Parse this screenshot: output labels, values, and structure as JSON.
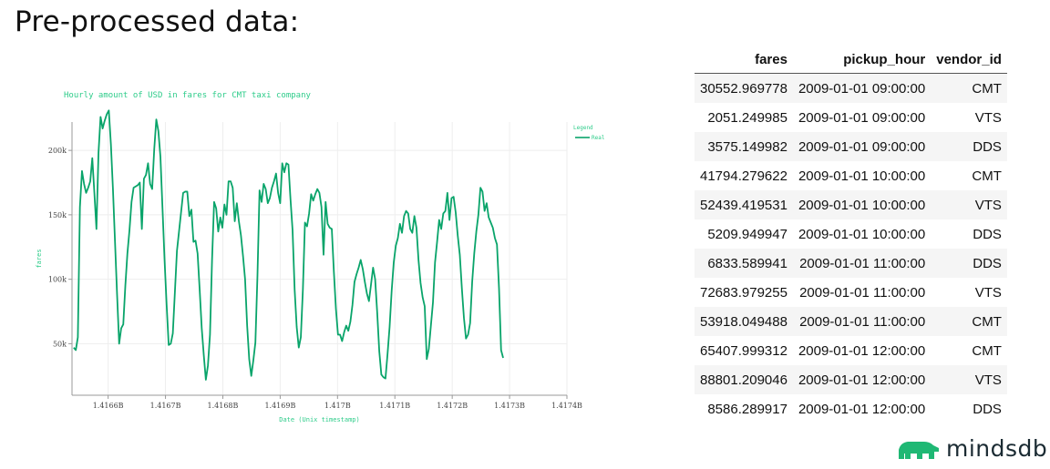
{
  "slide": {
    "title": "Pre-processed data:"
  },
  "colors": {
    "line": "#09a46a",
    "chart_text": "#2ecc8a",
    "axis": "#999999",
    "grid": "#eeeeee",
    "logo": "#1fb874"
  },
  "chart_data": {
    "type": "line",
    "title": "Hourly amount of USD in fares for CMT taxi company",
    "xlabel": "Date (Unix timestamp)",
    "ylabel": "fares",
    "legend": {
      "title": "Legend",
      "position": "top-right",
      "entries": [
        "Real"
      ]
    },
    "grid": true,
    "x_ticks": [
      "1.4166B",
      "1.4167B",
      "1.4168B",
      "1.4169B",
      "1.417B",
      "1.4171B",
      "1.4172B",
      "1.4173B",
      "1.4174B"
    ],
    "x_tick_values": [
      1416600000,
      1416700000,
      1416800000,
      1416900000,
      1417000000,
      1417100000,
      1417200000,
      1417300000,
      1417400000
    ],
    "y_ticks": [
      "50k",
      "100k",
      "150k",
      "200k"
    ],
    "y_tick_values": [
      50000,
      100000,
      150000,
      200000
    ],
    "xlim": [
      1416537000,
      1417400000
    ],
    "ylim": [
      10000,
      222000
    ],
    "series": [
      {
        "name": "Real",
        "x_start": 1416540000,
        "x_step": 3600,
        "values": [
          47000,
          45000,
          55000,
          156000,
          184000,
          174000,
          167000,
          171000,
          176000,
          194000,
          167000,
          139000,
          198000,
          226000,
          217000,
          223000,
          228000,
          231000,
          205000,
          170000,
          129000,
          88000,
          50000,
          62000,
          65000,
          95000,
          120000,
          138000,
          160000,
          171000,
          172000,
          173000,
          175000,
          139000,
          178000,
          181000,
          190000,
          174000,
          170000,
          201000,
          224000,
          215000,
          195000,
          155000,
          115000,
          80000,
          49000,
          50000,
          58000,
          90000,
          122000,
          137000,
          152000,
          167000,
          168000,
          168000,
          149000,
          154000,
          129000,
          130000,
          120000,
          92000,
          62000,
          41000,
          22000,
          33000,
          57000,
          115000,
          160000,
          155000,
          137000,
          148000,
          140000,
          158000,
          150000,
          176000,
          176000,
          171000,
          145000,
          159000,
          145000,
          134000,
          118000,
          100000,
          64000,
          38000,
          25000,
          37000,
          51000,
          103000,
          169000,
          160000,
          174000,
          170000,
          159000,
          163000,
          171000,
          176000,
          182000,
          167000,
          159000,
          190000,
          183000,
          190000,
          189000,
          162000,
          138000,
          92000,
          63000,
          47000,
          55000,
          92000,
          144000,
          141000,
          151000,
          166000,
          161000,
          166000,
          170000,
          167000,
          156000,
          119000,
          160000,
          143000,
          140000,
          139000,
          106000,
          77000,
          57000,
          57000,
          52000,
          59000,
          64000,
          60000,
          67000,
          80000,
          98000,
          104000,
          109000,
          115000,
          108000,
          98000,
          89000,
          83000,
          96000,
          109000,
          100000,
          74000,
          44000,
          26000,
          24000,
          23000,
          42000,
          63000,
          91000,
          113000,
          126000,
          132000,
          143000,
          136000,
          149000,
          153000,
          151000,
          139000,
          136000,
          149000,
          140000,
          115000,
          97000,
          86000,
          79000,
          38000,
          46000,
          64000,
          82000,
          113000,
          129000,
          146000,
          139000,
          151000,
          153000,
          167000,
          146000,
          163000,
          164000,
          152000,
          134000,
          119000,
          93000,
          70000,
          54000,
          57000,
          66000,
          98000,
          120000,
          137000,
          150000,
          171000,
          168000,
          153000,
          159000,
          148000,
          144000,
          140000,
          132000,
          127000,
          93000,
          45000,
          39000
        ]
      }
    ]
  },
  "table": {
    "columns": [
      "fares",
      "pickup_hour",
      "vendor_id"
    ],
    "rows": [
      [
        "30552.969778",
        "2009-01-01 09:00:00",
        "CMT"
      ],
      [
        "2051.249985",
        "2009-01-01 09:00:00",
        "VTS"
      ],
      [
        "3575.149982",
        "2009-01-01 09:00:00",
        "DDS"
      ],
      [
        "41794.279622",
        "2009-01-01 10:00:00",
        "CMT"
      ],
      [
        "52439.419531",
        "2009-01-01 10:00:00",
        "VTS"
      ],
      [
        "5209.949947",
        "2009-01-01 10:00:00",
        "DDS"
      ],
      [
        "6833.589941",
        "2009-01-01 11:00:00",
        "DDS"
      ],
      [
        "72683.979255",
        "2009-01-01 11:00:00",
        "VTS"
      ],
      [
        "53918.049488",
        "2009-01-01 11:00:00",
        "CMT"
      ],
      [
        "65407.999312",
        "2009-01-01 12:00:00",
        "CMT"
      ],
      [
        "88801.209046",
        "2009-01-01 12:00:00",
        "VTS"
      ],
      [
        "8586.289917",
        "2009-01-01 12:00:00",
        "DDS"
      ]
    ]
  },
  "logo": {
    "text": "mindsdb",
    "icon": "bear-icon"
  }
}
